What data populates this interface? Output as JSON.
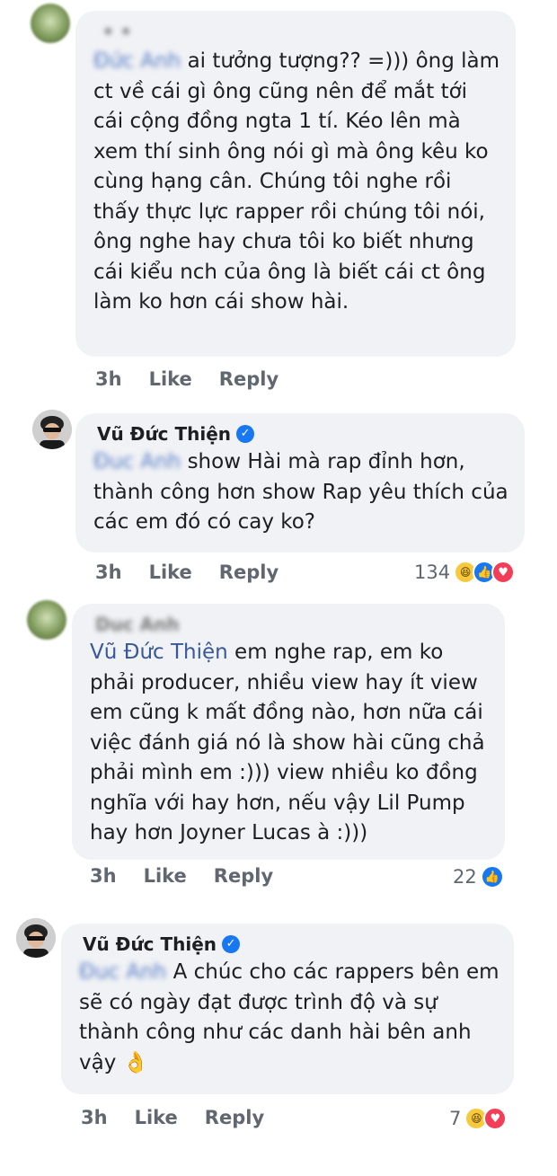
{
  "comments": [
    {
      "author": "• •",
      "mention": "Đức Anh",
      "text": "ai tưởng tượng?? =))) ông làm ct về cái gì ông cũng nên để mắt tới cái cộng đồng ngta 1 tí. Kéo lên mà xem thí sinh ông nói gì mà ông kêu ko cùng hạng cân. Chúng tôi nghe rồi thấy thực lực rapper rồi chúng tôi nói, ông nghe hay chưa tôi ko biết nhưng cái kiểu nch của ông là biết cái ct ông làm ko hơn cái show hài.",
      "time": "3h",
      "like": "Like",
      "reply": "Reply"
    },
    {
      "author": "Vũ Đức Thiện",
      "mention": "Đuc Anh",
      "text": "show Hài mà rap đỉnh hơn, thành công hơn show Rap yêu thích của các em đó có cay ko?",
      "time": "3h",
      "like": "Like",
      "reply": "Reply",
      "reaction_count": "134"
    },
    {
      "author": "Duc Anh",
      "mention": "Vũ Đức Thiện",
      "text": "em nghe rap, em ko phải producer, nhiều view hay ít view em cũng k mất đồng nào, hơn nữa cái việc đánh giá nó là show hài cũng chả phải mình em :))) view nhiều ko đồng nghĩa với hay hơn, nếu vậy Lil Pump hay hơn Joyner Lucas à :)))",
      "time": "3h",
      "like": "Like",
      "reply": "Reply",
      "reaction_count": "22"
    },
    {
      "author": "Vũ Đức Thiện",
      "mention": "Đuc Anh",
      "text": "A chúc cho các rappers bên em sẽ có ngày đạt được trình độ và sự thành công như các danh hài bên anh vậy 👌",
      "time": "3h",
      "like": "Like",
      "reply": "Reply",
      "reaction_count": "7"
    }
  ],
  "colors": {
    "bubble": "#f0f2f5",
    "link": "#385898",
    "meta": "#606770",
    "verified": "#1877f2"
  },
  "icons": {
    "verified": "check-badge-icon",
    "haha": "haha-reaction-icon",
    "like": "like-reaction-icon",
    "love": "love-reaction-icon",
    "ok_hand": "ok-hand-emoji"
  }
}
